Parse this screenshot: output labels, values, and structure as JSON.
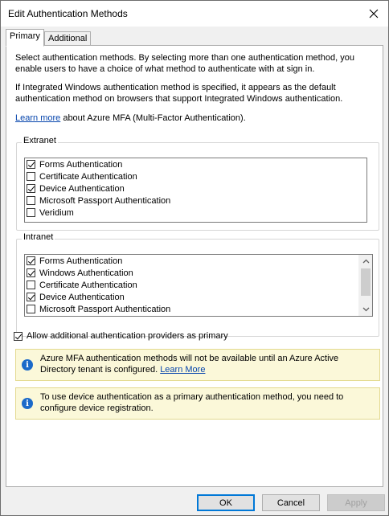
{
  "window": {
    "title": "Edit Authentication Methods",
    "close_glyph": "✕"
  },
  "tabs": [
    {
      "label": "Primary",
      "active": true
    },
    {
      "label": "Additional",
      "active": false
    }
  ],
  "intro": {
    "p1": "Select authentication methods. By selecting more than one authentication method, you enable users to have a choice of what method to authenticate with at sign in.",
    "p2": "If Integrated Windows authentication method is specified, it appears as the default authentication method on browsers that support Integrated Windows authentication.",
    "learn_link": "Learn more",
    "learn_suffix": " about Azure MFA (Multi-Factor Authentication)."
  },
  "extranet": {
    "label": "Extranet",
    "items": [
      {
        "label": "Forms Authentication",
        "checked": true
      },
      {
        "label": "Certificate Authentication",
        "checked": false
      },
      {
        "label": "Device Authentication",
        "checked": true
      },
      {
        "label": "Microsoft Passport Authentication",
        "checked": false
      },
      {
        "label": "Veridium",
        "checked": false
      }
    ]
  },
  "intranet": {
    "label": "Intranet",
    "items": [
      {
        "label": "Forms Authentication",
        "checked": true
      },
      {
        "label": "Windows Authentication",
        "checked": true
      },
      {
        "label": "Certificate Authentication",
        "checked": false
      },
      {
        "label": "Device Authentication",
        "checked": true
      },
      {
        "label": "Microsoft Passport Authentication",
        "checked": false
      }
    ]
  },
  "allow_additional": {
    "label": "Allow additional authentication providers as primary",
    "checked": true
  },
  "info1": {
    "text": "Azure MFA authentication methods will not be available until an Azure Active Directory tenant is configured. ",
    "link": "Learn More"
  },
  "info2": {
    "text": "To use device authentication as a primary authentication method, you need to configure device registration."
  },
  "info_icon_glyph": "i",
  "buttons": {
    "ok": "OK",
    "cancel": "Cancel",
    "apply": "Apply"
  }
}
